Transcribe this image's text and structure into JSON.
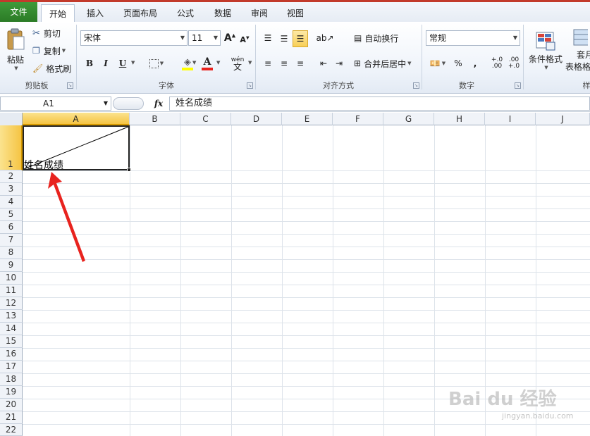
{
  "tabs": {
    "file": "文件",
    "home": "开始",
    "insert": "插入",
    "page_layout": "页面布局",
    "formulas": "公式",
    "data": "数据",
    "review": "审阅",
    "view": "视图"
  },
  "clipboard": {
    "paste": "粘贴",
    "cut": "剪切",
    "copy": "复制",
    "format_painter": "格式刷",
    "group_label": "剪贴板"
  },
  "font": {
    "name": "宋体",
    "size": "11",
    "bold": "B",
    "italic": "I",
    "underline": "U",
    "wen": "wén",
    "wen_char": "文",
    "group_label": "字体"
  },
  "alignment": {
    "wrap_text": "自动换行",
    "merge_center": "合并后居中",
    "group_label": "对齐方式"
  },
  "number": {
    "format": "常规",
    "percent": "%",
    "comma": ",",
    "inc_decimal": "+.0 .00",
    "dec_decimal": ".00 +.0",
    "group_label": "数字"
  },
  "styles": {
    "conditional_format": "条件格式",
    "table_format_top": "套月",
    "table_format_bottom": "表格格",
    "group_label_partial": "样"
  },
  "formula_bar": {
    "name_box": "A1",
    "fx": "fx",
    "value": "姓名成绩"
  },
  "columns": [
    "A",
    "B",
    "C",
    "D",
    "E",
    "F",
    "G",
    "H",
    "I",
    "J"
  ],
  "rows": [
    "1",
    "2",
    "3",
    "4",
    "5",
    "6",
    "7",
    "8",
    "9",
    "10",
    "11",
    "12",
    "13",
    "14",
    "15",
    "16",
    "17",
    "18",
    "19",
    "20",
    "21",
    "22"
  ],
  "cells": {
    "A1": "姓名成绩"
  },
  "selected": {
    "column": "A",
    "row": "1"
  },
  "watermark": {
    "main": "Bai du 经验",
    "sub": "jingyan.baidu.com"
  },
  "colors": {
    "file_tab": "#2f8a2a",
    "selection_header": "#f5c444",
    "arrow": "#e8231e",
    "accent_red": "#c23a2b"
  }
}
